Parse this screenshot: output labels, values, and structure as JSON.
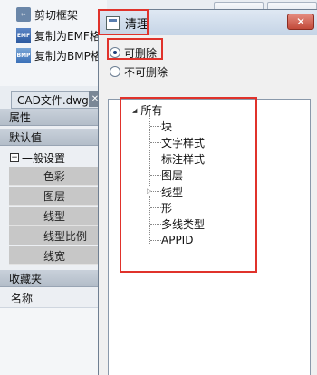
{
  "ribbon": {
    "items": [
      {
        "icon": "cut-frame-icon",
        "label": "剪切框架"
      },
      {
        "icon": "emf-icon",
        "label": "复制为EMF格"
      },
      {
        "icon": "bmp-icon",
        "label": "复制为BMP格"
      }
    ]
  },
  "document_tab": {
    "label": "CAD文件.dwg",
    "close_glyph": "✕"
  },
  "properties_panel": {
    "header": "属性",
    "defaults_header": "默认值",
    "group": {
      "expander": "−",
      "label": "一般设置"
    },
    "rows": [
      "色彩",
      "图层",
      "线型",
      "线型比例",
      "线宽"
    ],
    "favorites_header": "收藏夹",
    "name_label": "名称"
  },
  "dialog": {
    "title": "清理",
    "close_glyph": "✕",
    "radio_options": [
      {
        "label": "可删除",
        "selected": true
      },
      {
        "label": "不可删除",
        "selected": false
      }
    ],
    "tree": {
      "root": "所有",
      "items": [
        "块",
        "文字样式",
        "标注样式",
        "图层",
        "线型",
        "形",
        "多线类型",
        "APPID"
      ]
    }
  },
  "colors": {
    "highlight": "#e0322b",
    "title_bar": "#c5d4e6",
    "close_button": "#c24a3a",
    "property_row": "#c7c7c7"
  }
}
